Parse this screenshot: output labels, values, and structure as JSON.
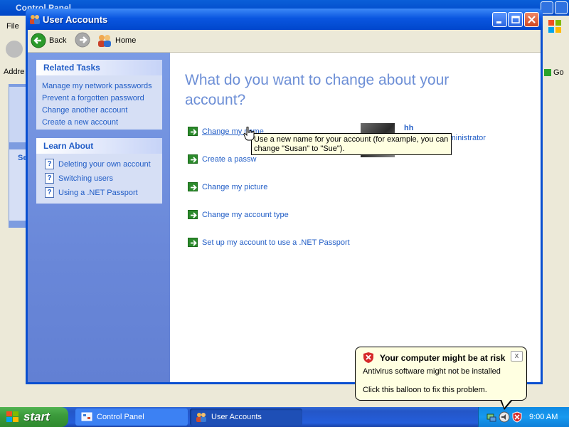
{
  "background_window": {
    "title": "Control Panel",
    "menu_file": "File",
    "address_label": "Addre",
    "go_label": "Go",
    "sidebar_fragment": "Se"
  },
  "window": {
    "title": "User Accounts"
  },
  "toolbar": {
    "back_label": "Back",
    "home_label": "Home"
  },
  "related_tasks": {
    "heading": "Related Tasks",
    "links": [
      "Manage my network passwords",
      "Prevent a forgotten password",
      "Change another account",
      "Create a new account"
    ]
  },
  "learn_about": {
    "heading": "Learn About",
    "items": [
      "Deleting your own account",
      "Switching users",
      "Using a .NET Passport"
    ]
  },
  "main": {
    "heading": "What do you want to change about your account?",
    "choices": [
      "Change my name",
      "Create a password",
      "Change my picture",
      "Change my account type",
      "Set up my account to use a .NET Passport"
    ],
    "choice_1_visible": "Create a passw"
  },
  "user": {
    "name": "hh",
    "role": "Computer administrator",
    "role_visible": "Computer administrator"
  },
  "tooltip": {
    "text": "Use a new name for your account (for example, you can change \"Susan\" to \"Sue\")."
  },
  "taskbar": {
    "start_label": "start",
    "tasks": [
      "Control Panel",
      "User Accounts"
    ],
    "clock": "9:00 AM"
  },
  "balloon": {
    "title": "Your computer might be at risk",
    "line1": "Antivirus software might not be installed",
    "line2": "Click this balloon to fix this problem.",
    "close_label": "x"
  },
  "colors": {
    "link": "#215dc6",
    "heading": "#6d8fd6",
    "left_pane": "#7a9be5",
    "task_box": "#d6dff5",
    "tooltip_bg": "#ffffe1",
    "taskbar": "#245edb",
    "start_green": "#3c9b3c"
  },
  "icons": {
    "window_icon": "users-icon",
    "back": "back-arrow-icon",
    "forward": "forward-arrow-icon",
    "home": "home-users-icon",
    "choice": "green-arrow-icon",
    "help": "help-question-icon",
    "balloon": "security-shield-icon"
  }
}
